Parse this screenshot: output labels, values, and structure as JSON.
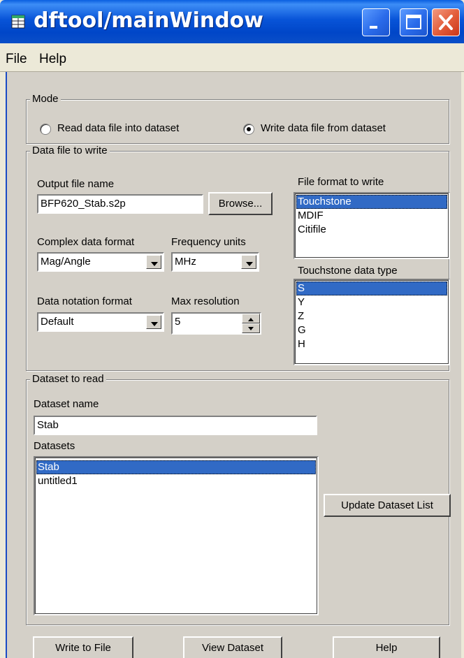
{
  "window": {
    "title": "dftool/mainWindow",
    "minimize_icon": "minimize-icon",
    "maximize_icon": "maximize-icon",
    "close_icon": "close-icon"
  },
  "menu": {
    "file": "File",
    "help": "Help"
  },
  "mode": {
    "legend": "Mode",
    "options": [
      {
        "label": "Read data file into dataset",
        "selected": false
      },
      {
        "label": "Write data file from dataset",
        "selected": true
      }
    ]
  },
  "data_file": {
    "legend": "Data file to write",
    "output_label": "Output file name",
    "output_value": "BFP620_Stab.s2p",
    "browse_label": "Browse...",
    "complex_label": "Complex data format",
    "complex_value": "Mag/Angle",
    "freq_label": "Frequency units",
    "freq_value": "MHz",
    "notation_label": "Data notation format",
    "notation_value": "Default",
    "maxres_label": "Max resolution",
    "maxres_value": "5",
    "format_label": "File format to write",
    "formats": [
      "Touchstone",
      "MDIF",
      "Citifile"
    ],
    "format_selected": "Touchstone",
    "ts_type_label": "Touchstone data type",
    "ts_types": [
      "S",
      "Y",
      "Z",
      "G",
      "H"
    ],
    "ts_type_selected": "S"
  },
  "dataset": {
    "legend": "Dataset to read",
    "name_label": "Dataset name",
    "name_value": "Stab",
    "list_label": "Datasets",
    "items": [
      "Stab",
      "untitled1"
    ],
    "selected": "Stab",
    "update_label": "Update Dataset List"
  },
  "footer": {
    "write_label": "Write to File",
    "view_label": "View Dataset",
    "help_label": "Help"
  },
  "colors": {
    "title_blue": "#0054e3",
    "selection": "#316ac5",
    "close_red": "#e25b38"
  }
}
